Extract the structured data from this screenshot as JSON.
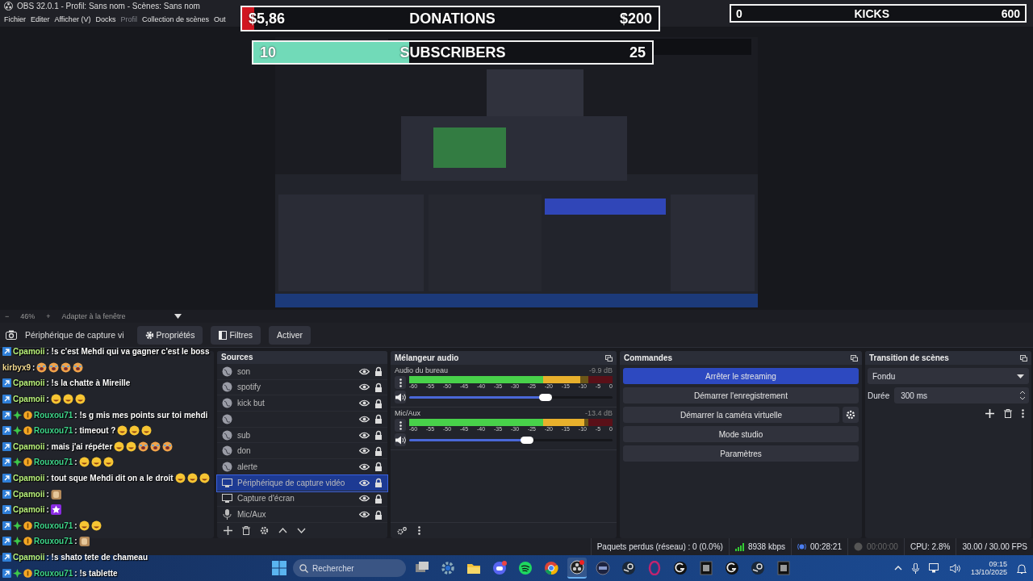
{
  "window": {
    "title": "OBS 32.0.1 - Profil: Sans nom - Scènes: Sans nom"
  },
  "menu": [
    {
      "label": "Fichier",
      "disabled": false
    },
    {
      "label": "Editer",
      "disabled": false
    },
    {
      "label": "Afficher (V)",
      "disabled": false
    },
    {
      "label": "Docks",
      "disabled": false
    },
    {
      "label": "Profil",
      "disabled": true
    },
    {
      "label": "Collection de scènes",
      "disabled": false
    },
    {
      "label": "Out",
      "disabled": false
    }
  ],
  "overlays": [
    {
      "kind": "donations",
      "current": "$5,86",
      "title": "DONATIONS",
      "target": "$200",
      "level": 0.03
    },
    {
      "kind": "subscribers",
      "current": "10",
      "title": "SUBSCRIBERS",
      "target": "25",
      "level": 0.39
    },
    {
      "kind": "kicks",
      "current": "0",
      "title": "KICKS",
      "target": "600",
      "level": 0
    }
  ],
  "zoom_bar": {
    "minus": "−",
    "zoom": "46%",
    "plus": "+",
    "fit": "Adapter à la fenêtre"
  },
  "source_toolbar": {
    "source": "Périphérique de capture vi",
    "buttons": [
      {
        "kind": "gear",
        "label": "Propriétés"
      },
      {
        "kind": "filter",
        "label": "Filtres"
      },
      {
        "kind": "plain",
        "label": "Activer"
      }
    ]
  },
  "chat": [
    {
      "user": "Cpamoii",
      "color": "#b8f07a",
      "badges": [
        {
          "kind": "sub"
        }
      ],
      "message": ": !s c'est Mehdi qui va gagner c'est le boss"
    },
    {
      "user": "kirbyx9",
      "color": "#f0d890",
      "message": ":",
      "emotes": [
        {
          "kind": "cry"
        },
        {
          "kind": "cry"
        },
        {
          "kind": "cry"
        },
        {
          "kind": "cry"
        }
      ]
    },
    {
      "user": "Cpamoii",
      "color": "#b8f07a",
      "badges": [
        {
          "kind": "sub"
        }
      ],
      "message": ": !s la chatte à Mireille"
    },
    {
      "user": "Cpamoii",
      "color": "#b8f07a",
      "badges": [
        {
          "kind": "sub"
        }
      ],
      "message": ":",
      "emotes": [
        {
          "kind": "laugh"
        },
        {
          "kind": "laugh"
        },
        {
          "kind": "laugh"
        }
      ]
    },
    {
      "user": "Rouxou71",
      "color": "#3ed68a",
      "badges": [
        {
          "kind": "sub"
        },
        {
          "kind": "sparkle"
        },
        {
          "kind": "coin"
        }
      ],
      "message": ": !s g mis mes points sur toi mehdi"
    },
    {
      "user": "Rouxou71",
      "color": "#3ed68a",
      "badges": [
        {
          "kind": "sub"
        },
        {
          "kind": "sparkle"
        },
        {
          "kind": "coin"
        }
      ],
      "message": ": timeout ?",
      "emotes": [
        {
          "kind": "laugh"
        },
        {
          "kind": "laugh"
        },
        {
          "kind": "laugh"
        }
      ]
    },
    {
      "user": "Cpamoii",
      "color": "#b8f07a",
      "badges": [
        {
          "kind": "sub"
        }
      ],
      "message": ": mais j'ai répéter",
      "emotes": [
        {
          "kind": "laugh"
        },
        {
          "kind": "laugh"
        },
        {
          "kind": "cry"
        },
        {
          "kind": "cry"
        },
        {
          "kind": "cry"
        }
      ]
    },
    {
      "user": "Rouxou71",
      "color": "#3ed68a",
      "badges": [
        {
          "kind": "sub"
        },
        {
          "kind": "sparkle"
        },
        {
          "kind": "coin"
        }
      ],
      "message": ":",
      "emotes": [
        {
          "kind": "laugh"
        },
        {
          "kind": "laugh"
        },
        {
          "kind": "laugh"
        }
      ]
    },
    {
      "user": "Cpamoii",
      "color": "#b8f07a",
      "badges": [
        {
          "kind": "sub"
        }
      ],
      "message": ": tout sque Mehdi dit on a le droit",
      "emotes": [
        {
          "kind": "laugh"
        },
        {
          "kind": "laugh"
        },
        {
          "kind": "laugh"
        }
      ]
    },
    {
      "user": "Cpamoii",
      "color": "#b8f07a",
      "badges": [
        {
          "kind": "sub"
        }
      ],
      "message": ":",
      "emotes": [
        {
          "kind": "sticker"
        }
      ]
    },
    {
      "user": "Cpamoii",
      "color": "#b8f07a",
      "badges": [
        {
          "kind": "sub"
        }
      ],
      "message": ":",
      "emotes": [
        {
          "kind": "star"
        }
      ]
    },
    {
      "user": "Rouxou71",
      "color": "#3ed68a",
      "badges": [
        {
          "kind": "sub"
        },
        {
          "kind": "sparkle"
        },
        {
          "kind": "coin"
        }
      ],
      "message": ":",
      "emotes": [
        {
          "kind": "laugh"
        },
        {
          "kind": "laugh"
        }
      ]
    },
    {
      "user": "Rouxou71",
      "color": "#3ed68a",
      "badges": [
        {
          "kind": "sub"
        },
        {
          "kind": "sparkle"
        },
        {
          "kind": "coin"
        }
      ],
      "message": ":",
      "emotes": [
        {
          "kind": "sticker"
        }
      ]
    },
    {
      "user": "Cpamoii",
      "color": "#b8f07a",
      "badges": [
        {
          "kind": "sub"
        }
      ],
      "message": ": !s shato tete de chameau"
    },
    {
      "user": "Rouxou71",
      "color": "#3ed68a",
      "badges": [
        {
          "kind": "sub"
        },
        {
          "kind": "sparkle"
        },
        {
          "kind": "coin"
        }
      ],
      "message": ": !s tablette"
    }
  ],
  "sources": {
    "title": "Sources",
    "items": [
      {
        "name": "son",
        "kind": "browser",
        "selected": false
      },
      {
        "name": "spotify",
        "kind": "browser",
        "selected": false
      },
      {
        "name": "kick but",
        "kind": "browser",
        "selected": false
      },
      {
        "kind": "browser",
        "selected": false
      },
      {
        "name": "sub",
        "kind": "browser",
        "selected": false
      },
      {
        "name": "don",
        "kind": "browser",
        "selected": false
      },
      {
        "name": "alerte",
        "kind": "browser",
        "selected": false
      },
      {
        "name": "Périphérique de capture vidéo",
        "kind": "camera",
        "selected": true
      },
      {
        "name": "Capture d'écran",
        "kind": "display",
        "selected": false
      },
      {
        "name": "Mic/Aux",
        "kind": "mic",
        "selected": false
      }
    ]
  },
  "mixer": {
    "title": "Mélangeur audio",
    "channels": [
      {
        "name": "Audio du bureau",
        "reading": "-9.9 dB",
        "level": 0.84,
        "scale": [
          "-60",
          "-55",
          "-50",
          "-45",
          "-40",
          "-35",
          "-30",
          "-25",
          "-20",
          "-15",
          "-10",
          "-5",
          "0"
        ],
        "volume": {
          "level": 0.67
        }
      },
      {
        "name": "Mic/Aux",
        "reading": "-13.4 dB",
        "level": 0.86,
        "scale": [
          "-60",
          "-55",
          "-50",
          "-45",
          "-40",
          "-35",
          "-30",
          "-25",
          "-20",
          "-15",
          "-10",
          "-5",
          "0"
        ],
        "volume": {
          "level": 0.58
        }
      }
    ]
  },
  "commands": {
    "title": "Commandes",
    "buttons": [
      {
        "label": "Arrêter le streaming",
        "active": true,
        "settings": false
      },
      {
        "label": "Démarrer l'enregistrement",
        "active": false,
        "settings": false
      },
      {
        "label": "Démarrer la caméra virtuelle",
        "active": false,
        "settings": true
      },
      {
        "label": "Mode studio",
        "active": false,
        "settings": false
      },
      {
        "label": "Paramètres",
        "active": false,
        "settings": false
      }
    ]
  },
  "transition": {
    "title": "Transition de scènes",
    "type": "Fondu",
    "duration_label": "Durée",
    "duration": "300 ms"
  },
  "status_bar": {
    "dropped": "Paquets perdus (réseau) : 0 (0.0%)",
    "bitrate": "8938 kbps",
    "stream_time": "00:28:21",
    "streaming": true,
    "record_time": "00:00:00",
    "recording": false,
    "cpu": "CPU: 2.8%",
    "fps": "30.00 / 30.00 FPS"
  },
  "taskbar": {
    "search": {
      "placeholder": "Rechercher"
    },
    "apps": [
      {
        "kind": "taskview",
        "active": false
      },
      {
        "kind": "gear",
        "active": false
      },
      {
        "kind": "folder",
        "active": false
      },
      {
        "kind": "chat",
        "active": false
      },
      {
        "kind": "music",
        "active": false
      },
      {
        "kind": "browser",
        "active": false
      },
      {
        "kind": "recorder",
        "active": true
      },
      {
        "kind": "tile",
        "active": false
      },
      {
        "kind": "steam",
        "active": false
      },
      {
        "kind": "ring",
        "active": false
      },
      {
        "kind": "logi",
        "active": false
      },
      {
        "kind": "dark",
        "active": false
      },
      {
        "kind": "logi",
        "active": false
      },
      {
        "kind": "steam",
        "active": false
      },
      {
        "kind": "dark",
        "active": false
      }
    ],
    "time": "09:15",
    "date": "13/10/2025"
  }
}
